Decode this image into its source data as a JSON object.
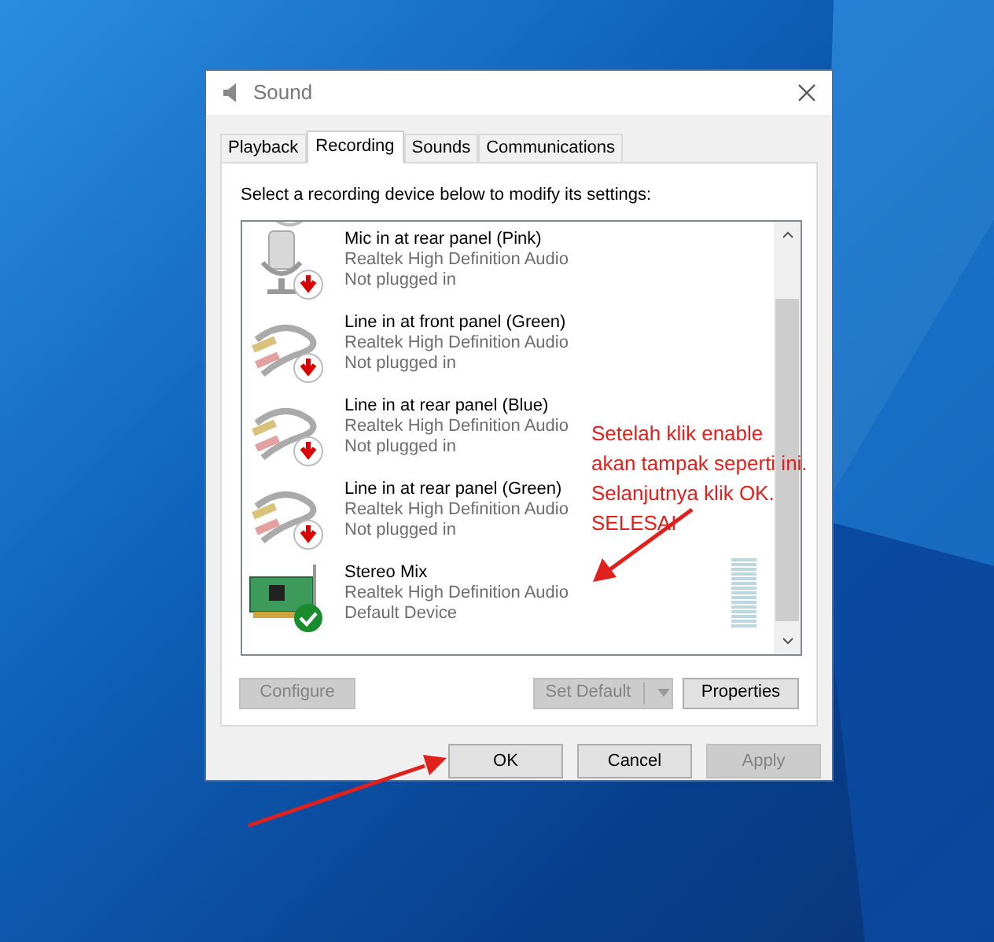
{
  "window": {
    "title": "Sound"
  },
  "tabs": [
    {
      "label": "Playback",
      "selected": false
    },
    {
      "label": "Recording",
      "selected": true
    },
    {
      "label": "Sounds",
      "selected": false
    },
    {
      "label": "Communications",
      "selected": false
    }
  ],
  "instruction": "Select a recording device below to modify its settings:",
  "devices": [
    {
      "kind": "mic",
      "name": "Mic in at rear panel (Pink)",
      "driver": "Realtek High Definition Audio",
      "status": "Not plugged in",
      "plugged_in": false,
      "default": false
    },
    {
      "kind": "line",
      "name": "Line in at front panel (Green)",
      "driver": "Realtek High Definition Audio",
      "status": "Not plugged in",
      "plugged_in": false,
      "default": false
    },
    {
      "kind": "line",
      "name": "Line in at rear panel (Blue)",
      "driver": "Realtek High Definition Audio",
      "status": "Not plugged in",
      "plugged_in": false,
      "default": false
    },
    {
      "kind": "line",
      "name": "Line in at rear panel (Green)",
      "driver": "Realtek High Definition Audio",
      "status": "Not plugged in",
      "plugged_in": false,
      "default": false
    },
    {
      "kind": "card",
      "name": "Stereo Mix",
      "driver": "Realtek High Definition Audio",
      "status": "Default Device",
      "plugged_in": true,
      "default": true
    }
  ],
  "device_buttons": [
    {
      "label": "Configure",
      "disabled": true
    },
    {
      "label": "Set Default",
      "disabled": true
    },
    {
      "label": "Properties",
      "disabled": false
    }
  ],
  "dialog_buttons": [
    {
      "label": "OK",
      "disabled": false
    },
    {
      "label": "Cancel",
      "disabled": false
    },
    {
      "label": "Apply",
      "disabled": true
    }
  ],
  "annotation": {
    "lines": [
      "Setelah klik enable",
      "akan tampak seperti ini.",
      "Selanjutnya klik OK.",
      "SELESAI"
    ]
  }
}
